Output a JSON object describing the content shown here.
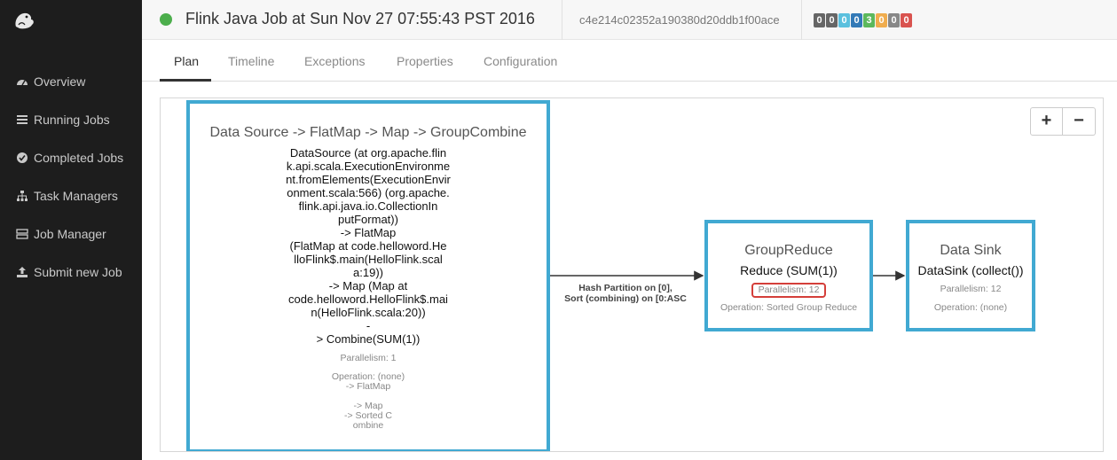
{
  "sidebar": {
    "items": [
      {
        "label": "Overview",
        "icon": "dashboard-icon"
      },
      {
        "label": "Running Jobs",
        "icon": "list-icon"
      },
      {
        "label": "Completed Jobs",
        "icon": "check-circle-icon"
      },
      {
        "label": "Task Managers",
        "icon": "sitemap-icon"
      },
      {
        "label": "Job Manager",
        "icon": "server-icon"
      },
      {
        "label": "Submit new Job",
        "icon": "upload-icon"
      }
    ]
  },
  "header": {
    "status_color": "#4cae4c",
    "title": "Flink Java Job at Sun Nov 27 07:55:43 PST 2016",
    "job_id": "c4e214c02352a190380d20ddb1f00ace",
    "counters": [
      {
        "value": "0",
        "color": "#666666"
      },
      {
        "value": "0",
        "color": "#666666"
      },
      {
        "value": "0",
        "color": "#5bc0de"
      },
      {
        "value": "0",
        "color": "#337ab7"
      },
      {
        "value": "3",
        "color": "#5cb85c"
      },
      {
        "value": "0",
        "color": "#f0ad4e"
      },
      {
        "value": "0",
        "color": "#888888"
      },
      {
        "value": "0",
        "color": "#d9534f"
      }
    ]
  },
  "tabs": [
    "Plan",
    "Timeline",
    "Exceptions",
    "Properties",
    "Configuration"
  ],
  "zoom": {
    "in": "+",
    "out": "−"
  },
  "plan": {
    "node1": {
      "title": "Data Source -> FlatMap -> Map -> GroupCombine",
      "desc": [
        "DataSource (at org.apache.flin",
        "k.api.scala.ExecutionEnvironme",
        "nt.fromElements(ExecutionEnvir",
        "onment.scala:566) (org.apache.",
        "flink.api.java.io.CollectionIn",
        "putFormat))",
        "-> FlatMap",
        "(FlatMap at code.helloword.He",
        "lloFlink$.main(HelloFlink.scal",
        "a:19))",
        "-> Map (Map at",
        "code.helloword.HelloFlink$.mai",
        "n(HelloFlink.scala:20))",
        "-",
        "> Combine(SUM(1))"
      ],
      "parallelism": "Parallelism: 1",
      "operation": [
        "Operation: (none)",
        "-> FlatMap",
        "",
        "-> Map",
        "-> Sorted C",
        "ombine"
      ]
    },
    "edge1": [
      "Hash Partition on [0],",
      "Sort (combining) on [0:ASC"
    ],
    "node2": {
      "title": "GroupReduce",
      "desc": "Reduce (SUM(1))",
      "parallelism": "Parallelism: 12",
      "operation": "Operation: Sorted Group Reduce"
    },
    "node3": {
      "title": "Data Sink",
      "desc": "DataSink (collect())",
      "parallelism": "Parallelism: 12",
      "operation": "Operation: (none)"
    }
  }
}
